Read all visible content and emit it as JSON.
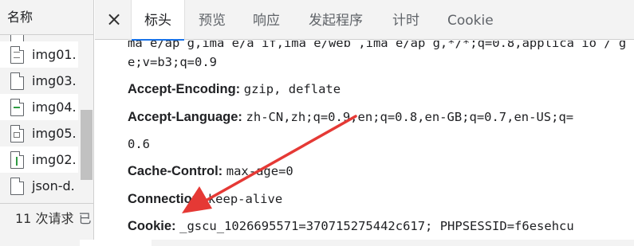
{
  "list": {
    "header": "名称",
    "files": [
      {
        "name": "img01.",
        "icon": "image-file-icon"
      },
      {
        "name": "img03.",
        "icon": "file-icon"
      },
      {
        "name": "img04.",
        "icon": "image-file-icon"
      },
      {
        "name": "img05.",
        "icon": "image-file-icon"
      },
      {
        "name": "img02.",
        "icon": "image-file-icon"
      },
      {
        "name": "json-d.",
        "icon": "file-icon"
      }
    ],
    "status": "11 次请求",
    "status_extra": "已"
  },
  "tabs": {
    "close_icon": "×",
    "items": [
      "标头",
      "预览",
      "响应",
      "发起程序",
      "计时",
      "Cookie"
    ],
    "active_index": 0
  },
  "headers": {
    "clipped_top": "ma e/ap g,ima e/a if,ima e/web ,ima e/ap g,*/*;q=0.8,applica io / g ed-e cha g",
    "accept_cont": "e;v=b3;q=0.9",
    "accept_encoding": {
      "name": "Accept-Encoding:",
      "value": "gzip, deflate"
    },
    "accept_language": {
      "name": "Accept-Language:",
      "value": "zh-CN,zh;q=0.9,en;q=0.8,en-GB;q=0.7,en-US;q=",
      "cont": "0.6"
    },
    "cache_control": {
      "name": "Cache-Control:",
      "value": "max-age=0"
    },
    "connection": {
      "name": "Connection:",
      "value": "keep-alive"
    },
    "cookie": {
      "name": "Cookie:",
      "value": "_gscu_1026695571=370715275442c617; PHPSESSID=f6esehcu"
    }
  },
  "colors": {
    "accent": "#1a73e8",
    "annotation_arrow": "#e53935"
  }
}
